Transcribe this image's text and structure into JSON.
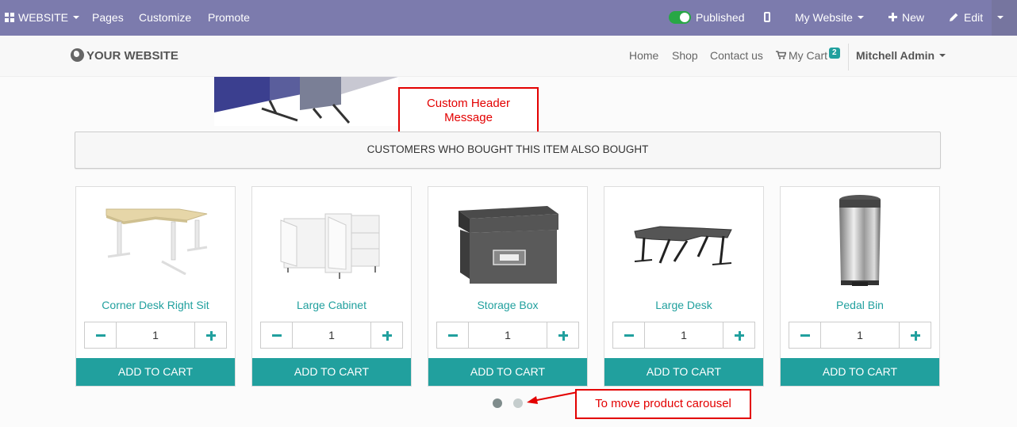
{
  "topbar": {
    "website_menu": "WEBSITE",
    "pages": "Pages",
    "customize": "Customize",
    "promote": "Promote",
    "published": "Published",
    "my_website": "My Website",
    "new": "New",
    "edit": "Edit"
  },
  "navbar": {
    "logo": "YOUR WEBSITE",
    "links": [
      "Home",
      "Shop",
      "Contact us"
    ],
    "cart_label": "My Cart",
    "cart_count": "2",
    "user": "Mitchell Admin"
  },
  "callouts": {
    "header": "Custom Header Message",
    "carousel": "To move product carousel"
  },
  "section": {
    "heading": "CUSTOMERS WHO BOUGHT THIS ITEM ALSO BOUGHT"
  },
  "products": [
    {
      "name": "Corner Desk Right Sit",
      "qty": "1",
      "button": "ADD TO CART",
      "image": "corner-desk"
    },
    {
      "name": "Large Cabinet",
      "qty": "1",
      "button": "ADD TO CART",
      "image": "cabinet"
    },
    {
      "name": "Storage Box",
      "qty": "1",
      "button": "ADD TO CART",
      "image": "storage-box"
    },
    {
      "name": "Large Desk",
      "qty": "1",
      "button": "ADD TO CART",
      "image": "large-desk"
    },
    {
      "name": "Pedal Bin",
      "qty": "1",
      "button": "ADD TO CART",
      "image": "pedal-bin"
    }
  ],
  "carousel": {
    "active_index": 0,
    "dots": 2
  },
  "colors": {
    "topbar": "#7c7bad",
    "accent": "#21a09e",
    "callout": "#e30000"
  }
}
